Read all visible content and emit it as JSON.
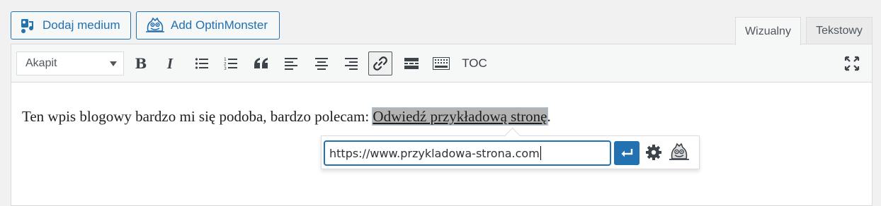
{
  "media_buttons": {
    "add_media": "Dodaj medium",
    "add_optinmonster": "Add OptinMonster"
  },
  "editor_tabs": {
    "visual": "Wizualny",
    "text": "Tekstowy"
  },
  "toolbar": {
    "format_select": "Akapit",
    "bold_label": "B",
    "italic_label": "I",
    "toc_label": "TOC",
    "active_button": "insert-link"
  },
  "content": {
    "text_before": "Ten wpis blogowy bardzo mi się podoba, bardzo polecam: ",
    "link_text": "Odwiedź przykładową stronę",
    "text_after": "."
  },
  "link_popup": {
    "url": "https://www.przykladowa-strona.com"
  },
  "colors": {
    "accent": "#2271b1",
    "selection": "#b3b3b3"
  }
}
